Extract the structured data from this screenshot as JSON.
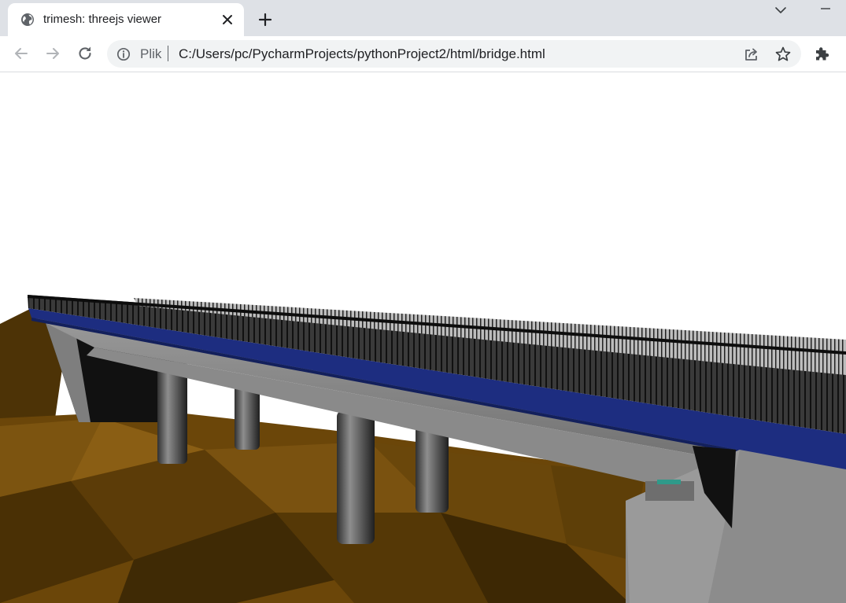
{
  "browser": {
    "tab": {
      "title": "trimesh: threejs viewer",
      "favicon": "globe-icon"
    },
    "omnibox": {
      "scheme_label": "Plik",
      "url": "C:/Users/pc/PycharmProjects/pythonProject2/html/bridge.html"
    },
    "icons": {
      "back": "arrow-left-icon",
      "forward": "arrow-right-icon",
      "reload": "reload-icon",
      "info": "info-icon",
      "share": "share-icon",
      "bookmark": "star-icon",
      "extensions": "puzzle-icon",
      "new_tab": "plus-icon",
      "close_tab": "close-icon",
      "tab_search": "chevron-down-icon",
      "minimize": "minimize-icon"
    }
  },
  "colors": {
    "tabstrip": "#dee1e6",
    "omnibox": "#f1f3f4",
    "terrain": "#6b4609",
    "deck_edge": "#1d2d80",
    "concrete": "#8a8a8a",
    "railing": "#1a1a1a"
  }
}
